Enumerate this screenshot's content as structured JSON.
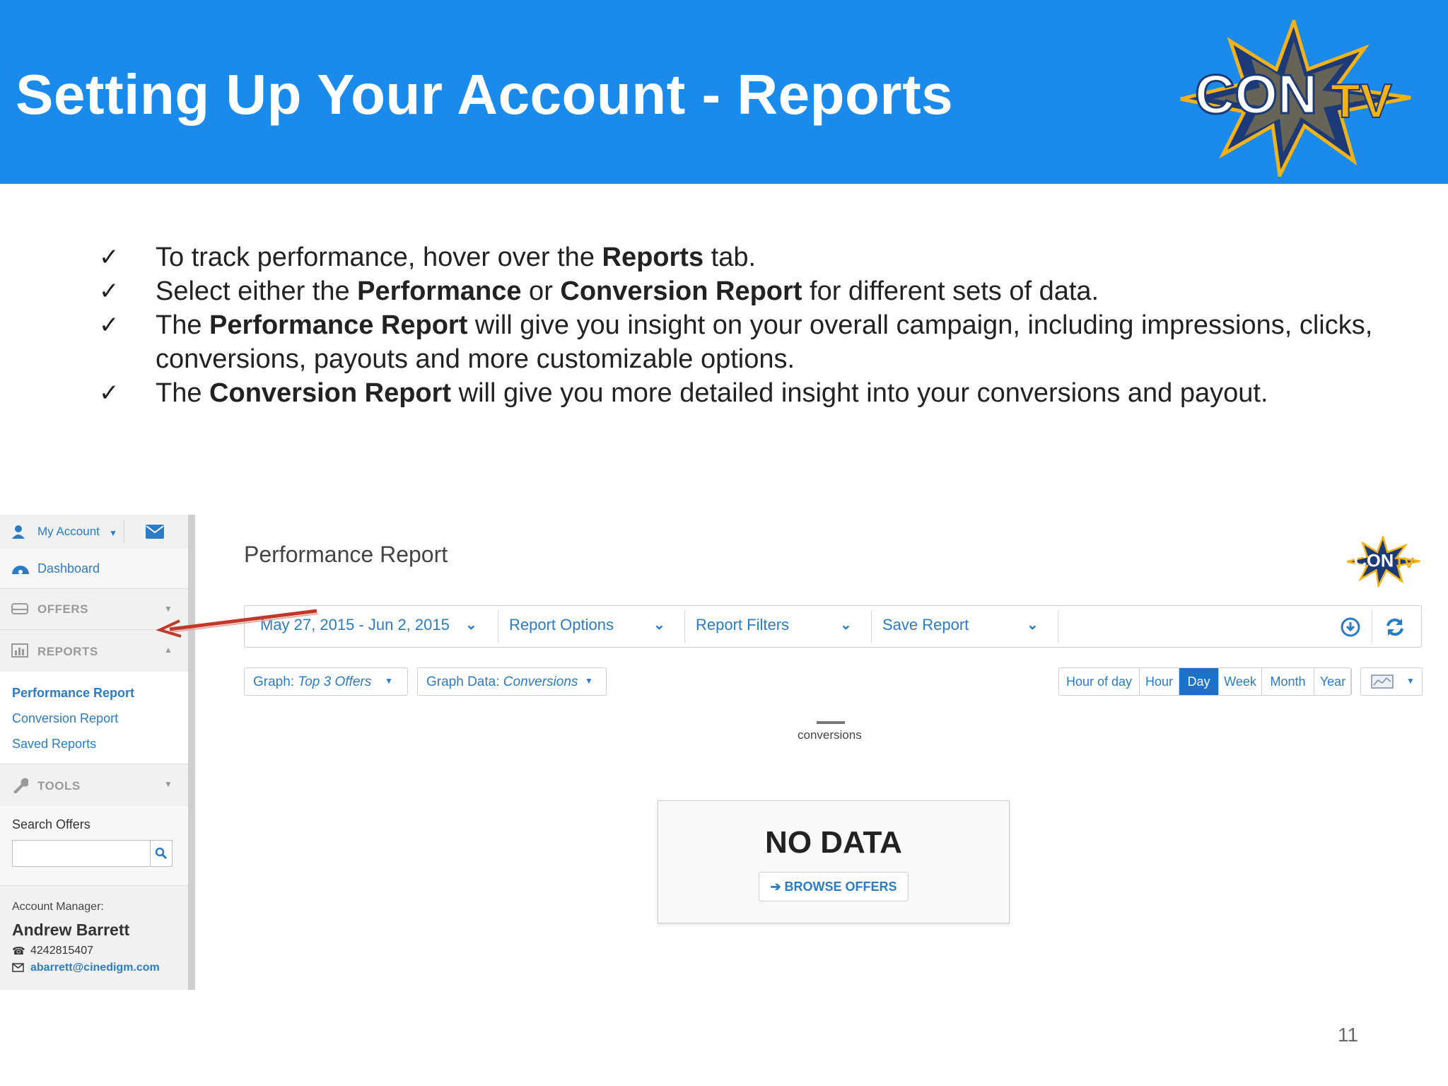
{
  "slide": {
    "title": "Setting Up Your Account - Reports",
    "logo_text": "CONTV",
    "page_number": "11"
  },
  "bullets": [
    {
      "check": "✓",
      "parts": [
        {
          "text": "To track performance, hover over the ",
          "bold": false
        },
        {
          "text": "Reports",
          "bold": true
        },
        {
          "text": " tab.",
          "bold": false
        }
      ]
    },
    {
      "check": "✓",
      "parts": [
        {
          "text": "Select either the ",
          "bold": false
        },
        {
          "text": "Performance",
          "bold": true
        },
        {
          "text": " or ",
          "bold": false
        },
        {
          "text": "Conversion Report",
          "bold": true
        },
        {
          "text": " for different sets of data.",
          "bold": false
        }
      ]
    },
    {
      "check": "✓",
      "parts": [
        {
          "text": "The ",
          "bold": false
        },
        {
          "text": "Performance Report",
          "bold": true
        },
        {
          "text": " will give you insight on your overall campaign, including impressions, clicks, conversions, payouts and more customizable options.",
          "bold": false
        }
      ]
    },
    {
      "check": "✓",
      "parts": [
        {
          "text": "The ",
          "bold": false
        },
        {
          "text": "Conversion Report",
          "bold": true
        },
        {
          "text": " will give you more detailed insight into your conversions and payout.",
          "bold": false
        }
      ]
    }
  ],
  "sidebar": {
    "my_account": "My Account",
    "dashboard": "Dashboard",
    "offers": "OFFERS",
    "reports": "REPORTS",
    "report_links": [
      "Performance Report",
      "Conversion Report",
      "Saved Reports"
    ],
    "tools": "TOOLS",
    "search_label": "Search Offers",
    "account_manager_label": "Account Manager:",
    "manager_name": "Andrew Barrett",
    "manager_phone": "4242815407",
    "manager_email": "abarrett@cinedigm.com"
  },
  "report": {
    "title": "Performance Report",
    "date_range": "May 27, 2015 - Jun 2, 2015",
    "report_options": "Report Options",
    "report_filters": "Report Filters",
    "save_report": "Save Report",
    "graph_label": "Graph: ",
    "graph_value": "Top 3 Offers",
    "graph_data_label": "Graph Data: ",
    "graph_data_value": "Conversions",
    "time_segments": [
      "Hour of day",
      "Hour",
      "Day",
      "Week",
      "Month",
      "Year"
    ],
    "active_segment": "Day",
    "legend": "conversions",
    "no_data": "NO DATA",
    "browse_offers": "BROWSE OFFERS"
  },
  "colors": {
    "banner": "#1a8bea",
    "link": "#2b7cc4",
    "active_segment": "#1a73c8",
    "arrow": "#c0392b"
  }
}
